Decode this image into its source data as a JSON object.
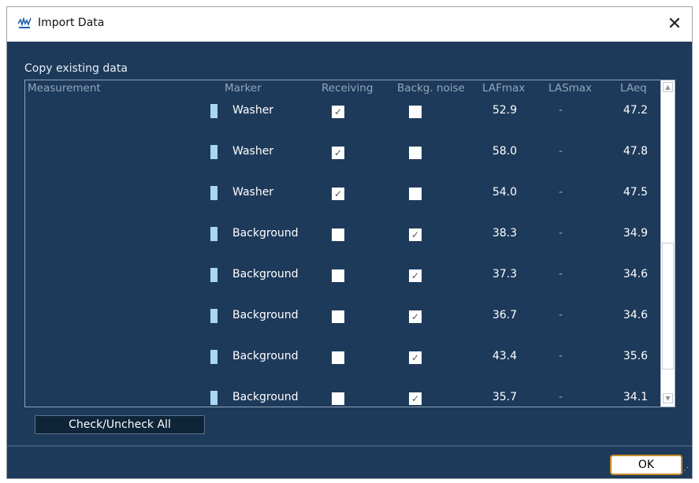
{
  "window": {
    "title": "Import Data",
    "close_glyph": "✕",
    "app_icon": "app-logo-icon"
  },
  "group": {
    "label": "Copy existing data"
  },
  "table": {
    "headers": {
      "measurement": "Measurement",
      "marker": "Marker",
      "receiving": "Receiving",
      "noise": "Backg. noise",
      "lafmax": "LAFmax",
      "lasmax": "LASmax",
      "laeq": "LAeq"
    },
    "rows": [
      {
        "marker": "Washer",
        "receiving": true,
        "noise": false,
        "lafmax": "52.9",
        "lasmax": "-",
        "laeq": "47.2"
      },
      {
        "marker": "Washer",
        "receiving": true,
        "noise": false,
        "lafmax": "58.0",
        "lasmax": "-",
        "laeq": "47.8"
      },
      {
        "marker": "Washer",
        "receiving": true,
        "noise": false,
        "lafmax": "54.0",
        "lasmax": "-",
        "laeq": "47.5"
      },
      {
        "marker": "Background",
        "receiving": false,
        "noise": true,
        "lafmax": "38.3",
        "lasmax": "-",
        "laeq": "34.9"
      },
      {
        "marker": "Background",
        "receiving": false,
        "noise": true,
        "lafmax": "37.3",
        "lasmax": "-",
        "laeq": "34.6"
      },
      {
        "marker": "Background",
        "receiving": false,
        "noise": true,
        "lafmax": "36.7",
        "lasmax": "-",
        "laeq": "34.6"
      },
      {
        "marker": "Background",
        "receiving": false,
        "noise": true,
        "lafmax": "43.4",
        "lasmax": "-",
        "laeq": "35.6"
      },
      {
        "marker": "Background",
        "receiving": false,
        "noise": true,
        "lafmax": "35.7",
        "lasmax": "-",
        "laeq": "34.1"
      }
    ]
  },
  "buttons": {
    "check_all": "Check/Uncheck All",
    "ok": "OK"
  },
  "colors": {
    "background": "#1e3a5a",
    "marker": "#a9d6f2",
    "ok_border": "#c58a27"
  }
}
